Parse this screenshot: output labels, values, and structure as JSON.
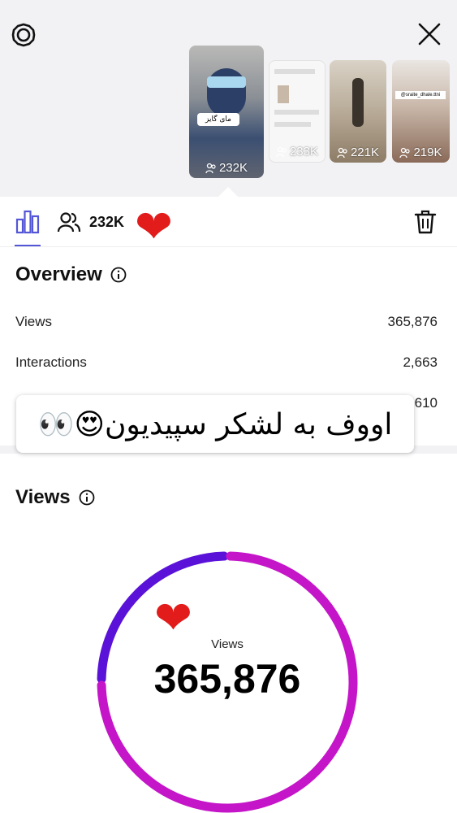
{
  "top_bar": {
    "settings_icon": "gear-icon",
    "close_icon": "close-icon"
  },
  "thumbnails": [
    {
      "count": "232K",
      "selected": true,
      "overlay_text": "مای گایز"
    },
    {
      "count": "233K",
      "selected": false
    },
    {
      "count": "221K",
      "selected": false
    },
    {
      "count": "219K",
      "selected": false,
      "overlay_text": "@sraite_dhale.ttni"
    }
  ],
  "tabs": {
    "stats_icon": "bar-chart-icon",
    "viewers_icon": "people-icon",
    "viewers_count": "232K",
    "delete_icon": "trash-icon"
  },
  "overview": {
    "title": "Overview",
    "rows": [
      {
        "label": "Views",
        "value": "365,876"
      },
      {
        "label": "Interactions",
        "value": "2,663"
      },
      {
        "label": "",
        "value": "610"
      }
    ]
  },
  "sticker": {
    "text": "اووف به لشکر سپیدیون😍👀"
  },
  "views_section": {
    "title": "Views",
    "ring_label": "Views",
    "ring_value": "365,876",
    "segments": [
      {
        "fraction": 0.25,
        "color": "#5a12d9"
      },
      {
        "fraction": 0.75,
        "color": "#c515c9"
      }
    ]
  },
  "colors": {
    "accent": "#5356d6",
    "heart": "#e21b1b"
  }
}
